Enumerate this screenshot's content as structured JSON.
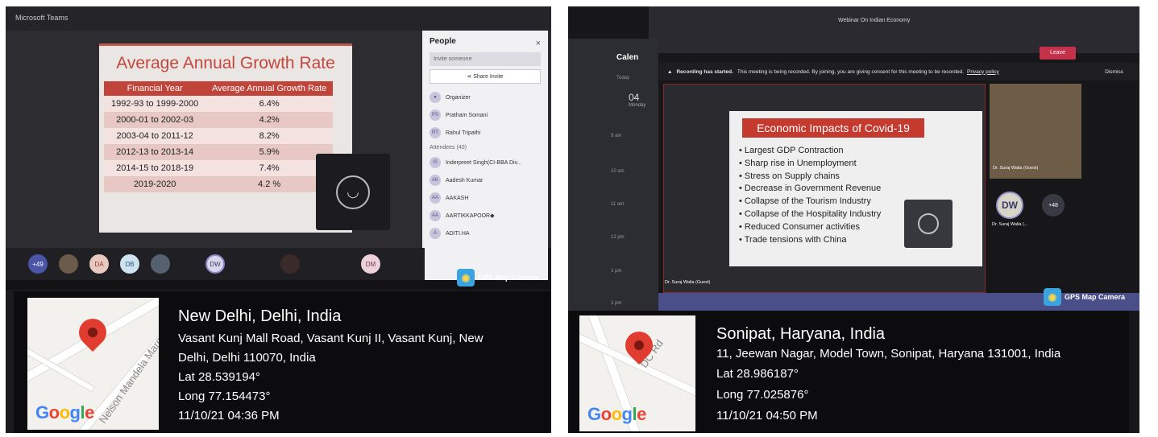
{
  "left": {
    "app_title": "Microsoft Teams",
    "slide": {
      "title": "Average Annual Growth Rate",
      "headers": [
        "Financial Year",
        "Average Annual Growth Rate"
      ],
      "rows": [
        [
          "1992-93 to 1999-2000",
          "6.4%"
        ],
        [
          "2000-01 to 2002-03",
          "4.2%"
        ],
        [
          "2003-04 to 2011-12",
          "8.2%"
        ],
        [
          "2012-13 to 2013-14",
          "5.9%"
        ],
        [
          "2014-15 to 2018-19",
          "7.4%"
        ],
        [
          "2019-2020",
          "4.2 %"
        ]
      ]
    },
    "people_panel": {
      "title": "People",
      "close": "×",
      "invite_placeholder": "Invite someone",
      "share_invite": "Share Invite",
      "organizer_label": "Organizer",
      "organizers": [
        {
          "initials": "PS",
          "name": "Pratham Somani"
        },
        {
          "initials": "RT",
          "name": "Rahul Tripathi"
        }
      ],
      "attendees_label": "Attendees (40)",
      "attendees": [
        {
          "initials": "IS",
          "name": "Inderpreet Singh(CI-BBA Div..."
        },
        {
          "initials": "AK",
          "name": "Aadesh Kumar"
        },
        {
          "initials": "AA",
          "name": "AAKASH"
        },
        {
          "initials": "AA",
          "name": "AARTIKKAPOOR◆"
        },
        {
          "initials": "A",
          "name": "ADITI.HA"
        }
      ]
    },
    "participants_bar": [
      "+49",
      "DA",
      "DB",
      "DW",
      "DM"
    ],
    "gps_badge": "GPS Map Camera",
    "location": {
      "title": "New Delhi, Delhi, India",
      "address_1": "Vasant Kunj Mall Road, Vasant Kunj II, Vasant Kunj, New",
      "address_2": "Delhi, Delhi 110070, India",
      "lat": "Lat 28.539194°",
      "long": "Long 77.154473°",
      "datetime": "11/10/21 04:36 PM",
      "map_road": "Nelson Mandela Marg",
      "google": "Google"
    }
  },
  "right": {
    "window_title": "Webinar On Indian Economy",
    "leave_label": "Leave",
    "calendar_label": "Calen",
    "today_label": "Today",
    "day_number": "04",
    "day_name": "Monday",
    "time_labels": [
      "9 am",
      "10 am",
      "11 am",
      "12 pm",
      "1 pm",
      "2 pm"
    ],
    "recording_banner": {
      "bold": "Recording has started.",
      "text": "This meeting is being recorded. By joining, you are giving consent for this meeting to be recorded.",
      "link": "Privacy policy",
      "dismiss": "Dismiss"
    },
    "slide": {
      "title": "Economic Impacts of Covid-19",
      "bullets": [
        "Largest GDP Contraction",
        "Sharp rise in Unemployment",
        "Stress on Supply chains",
        "Decrease in Government Revenue",
        "Collapse of the Tourism Industry",
        "Collapse of the Hospitality Industry",
        "Reduced Consumer activities",
        "Trade tensions with China"
      ]
    },
    "presenter_name": "Dr. Suraj Walia (Guest)",
    "side_tile_name": "Dr. Suraj Walia (Guest)",
    "dw_initials": "DW",
    "plus_count": "+48",
    "dw_name": "Dr. Suraj Walia (...",
    "gps_badge": "GPS Map Camera",
    "location": {
      "title": "Sonipat, Haryana, India",
      "address": "11, Jeewan Nagar, Model Town, Sonipat, Haryana 131001, India",
      "lat": "Lat 28.986187°",
      "long": "Long 77.025876°",
      "datetime": "11/10/21 04:50 PM",
      "map_road": "DC Rd",
      "google": "Google"
    }
  },
  "colors": {
    "teams_dark": "#2c2c31",
    "slide_red": "#c0443a",
    "leave_red": "#c4314b",
    "overlay": "#0a0a0c",
    "map_pin": "#e13c30"
  }
}
